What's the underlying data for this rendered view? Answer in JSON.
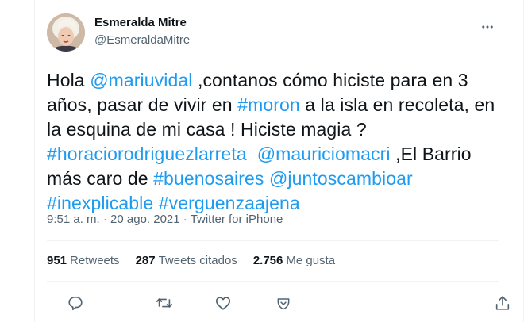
{
  "user": {
    "name": "Esmeralda Mitre",
    "handle": "@EsmeraldaMitre"
  },
  "tweet": {
    "lines": [
      [
        {
          "t": "Hola ",
          "link": false
        },
        {
          "t": "@mariuvidal",
          "link": true
        },
        {
          "t": " ,contanos cómo hiciste para en 3",
          "link": false
        }
      ],
      [
        {
          "t": "años, pasar de vivir en ",
          "link": false
        },
        {
          "t": "#moron",
          "link": true
        },
        {
          "t": " a la isla en recoleta, en",
          "link": false
        }
      ],
      [
        {
          "t": "la esquina de mi casa ! Hiciste magia ?",
          "link": false
        }
      ],
      [
        {
          "t": "#horaciorodriguezlarreta",
          "link": true
        },
        {
          "t": "  ",
          "link": false
        },
        {
          "t": "@mauriciomacri",
          "link": true
        },
        {
          "t": " ,El Barrio",
          "link": false
        }
      ],
      [
        {
          "t": "más caro de ",
          "link": false
        },
        {
          "t": "#buenosaires",
          "link": true
        },
        {
          "t": " ",
          "link": false
        },
        {
          "t": "@juntoscambioar",
          "link": true
        }
      ],
      [
        {
          "t": "#inexplicable",
          "link": true
        },
        {
          "t": " ",
          "link": false
        },
        {
          "t": "#verguenzaajena",
          "link": true
        }
      ]
    ],
    "meta": "9:51 a. m. · 20 ago. 2021 · Twitter for iPhone"
  },
  "stats": {
    "retweets_count": "951",
    "retweets_label": "Retweets",
    "quotes_count": "287",
    "quotes_label": "Tweets citados",
    "likes_count": "2.756",
    "likes_label": "Me gusta"
  },
  "icons": {
    "more": "more-icon",
    "reply": "reply-icon",
    "retweet": "retweet-icon",
    "like": "like-icon",
    "downvote": "downvote-icon",
    "share": "share-icon"
  },
  "colors": {
    "link": "#1d9bf0",
    "icon": "#536471",
    "text": "#0f1419",
    "secondary": "#536471"
  }
}
